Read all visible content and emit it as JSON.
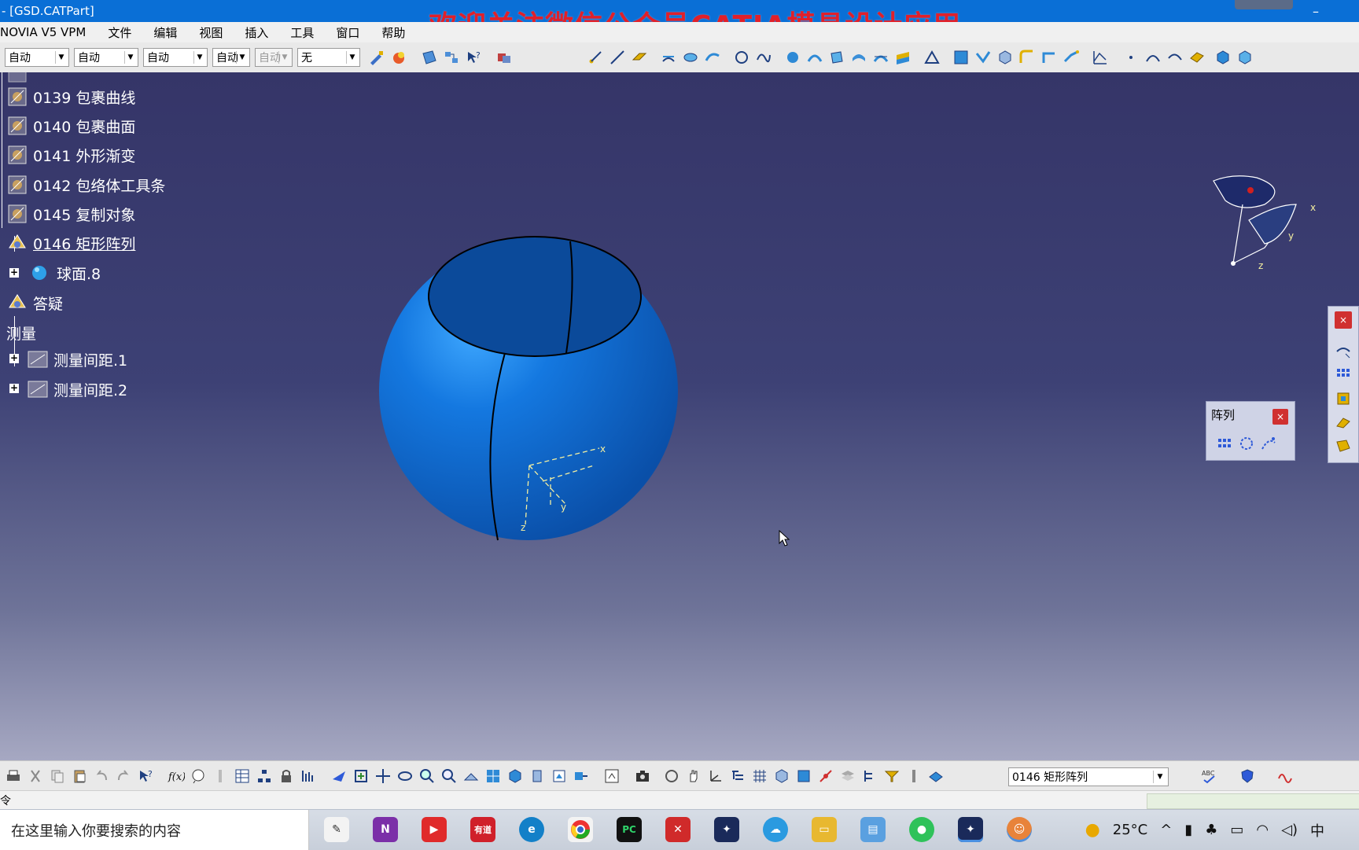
{
  "window": {
    "title": "- [GSD.CATPart]",
    "watermark": "欢迎关注微信公众号CATIA模具设计应用"
  },
  "menu": [
    "NOVIA V5 VPM",
    "文件",
    "编辑",
    "视图",
    "插入",
    "工具",
    "窗口",
    "帮助"
  ],
  "toolbar_combos": [
    {
      "value": "自动"
    },
    {
      "value": "自动"
    },
    {
      "value": "自动"
    },
    {
      "value": "自动"
    },
    {
      "value": "自动"
    },
    {
      "value": "无"
    }
  ],
  "tree": {
    "items": [
      {
        "label": "0139 包裹曲线"
      },
      {
        "label": "0140 包裹曲面"
      },
      {
        "label": "0141 外形渐变"
      },
      {
        "label": "0142 包络体工具条"
      },
      {
        "label": "0145 复制对象"
      },
      {
        "label": "0146 矩形阵列"
      },
      {
        "label": "球面.8"
      },
      {
        "label": "答疑"
      },
      {
        "label": "测量"
      },
      {
        "label": "测量间距.1"
      },
      {
        "label": "测量间距.2"
      }
    ]
  },
  "panels": {
    "array_title": "阵列",
    "close": "×"
  },
  "compass": {
    "x": "x",
    "y": "y",
    "z": "z"
  },
  "bottom_combo": {
    "value": "0146 矩形阵列"
  },
  "status": {
    "prompt": "令"
  },
  "taskbar": {
    "search_placeholder": "在这里输入你要搜索的内容",
    "weather": "25°C",
    "ime": "中"
  },
  "colors": {
    "titlebar": "#0a6fd6",
    "watermark": "#e0202a",
    "sphere": "#0a5fc8"
  }
}
